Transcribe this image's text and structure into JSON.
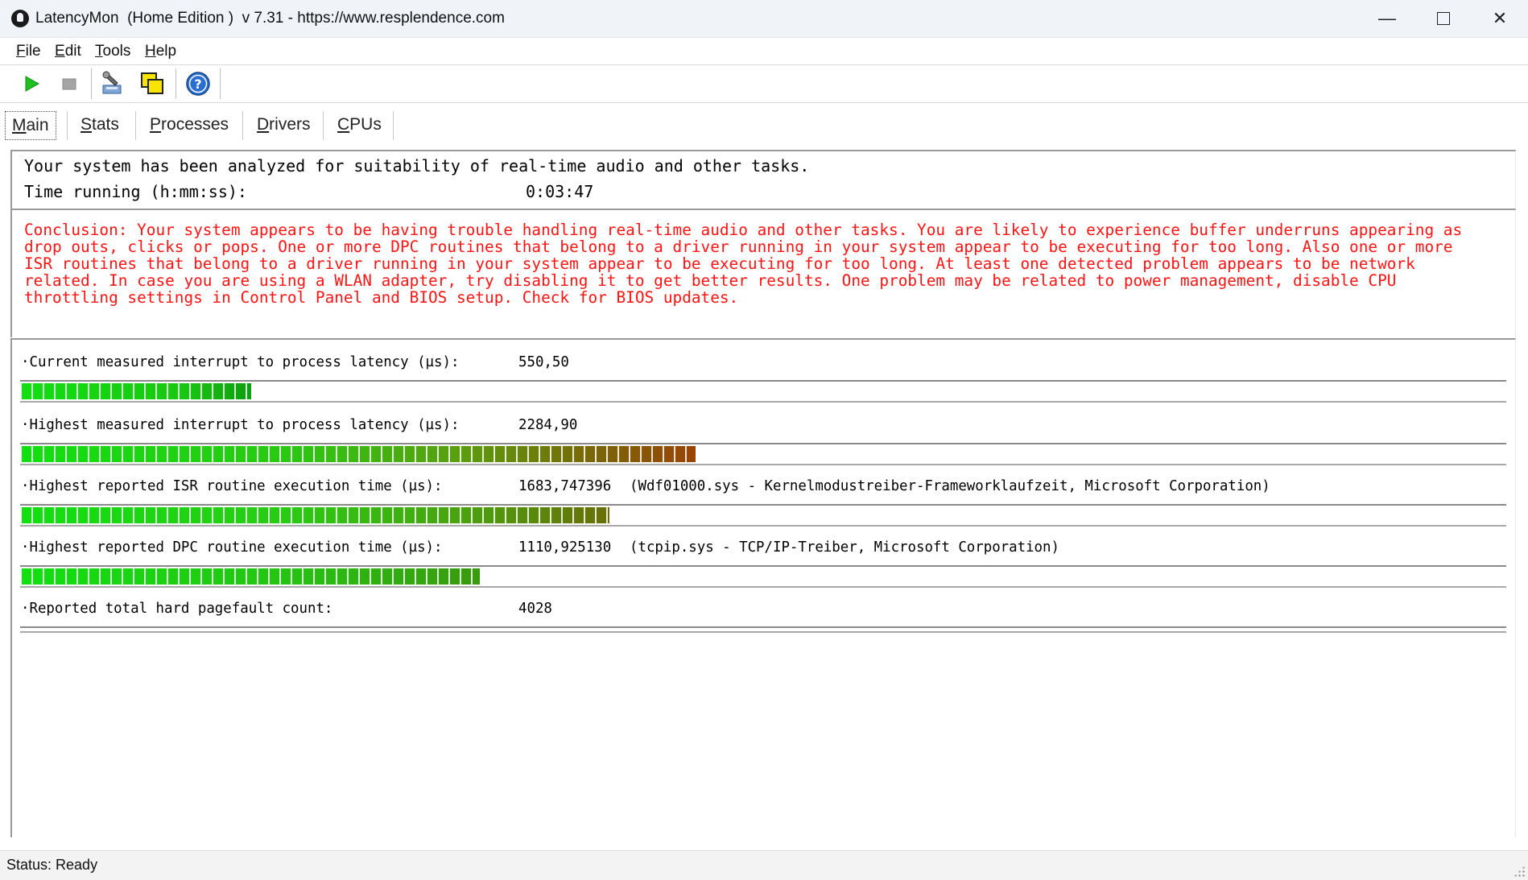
{
  "window": {
    "title": "LatencyMon  (Home Edition )  v 7.31 - https://www.resplendence.com",
    "minimize_glyph": "—",
    "close_glyph": "✕"
  },
  "menu": {
    "items": [
      {
        "label": "File"
      },
      {
        "label": "Edit"
      },
      {
        "label": "Tools"
      },
      {
        "label": "Help"
      }
    ]
  },
  "toolbar": {
    "icons": [
      "play-icon",
      "stop-icon",
      "driver-tool-icon",
      "copy-windows-icon",
      "help-icon"
    ],
    "colors": {
      "play": "#1fbf1f",
      "stop": "#a0a0a0",
      "help": "#1f5fbf"
    }
  },
  "tabs": [
    {
      "label": "Main",
      "active": true
    },
    {
      "label": "Stats"
    },
    {
      "label": "Processes"
    },
    {
      "label": "Drivers"
    },
    {
      "label": "CPUs"
    }
  ],
  "summary": {
    "analyzed_text": "Your system has been analyzed for suitability of real-time audio and other tasks.",
    "time_label": "Time running (h:mm:ss):",
    "time_value": "0:03:47"
  },
  "conclusion": {
    "text": "Conclusion: Your system appears to be having trouble handling real-time audio and other tasks. You are likely to experience buffer underruns appearing as\ndrop outs, clicks or pops. One or more DPC routines that belong to a driver running in your system appear to be executing for too long. Also one or more\nISR routines that belong to a driver running in your system appear to be executing for too long. At least one detected problem appears to be network\nrelated. In case you are using a WLAN adapter, try disabling it to get better results. One problem may be related to power management, disable CPU\nthrottling settings in Control Panel and BIOS setup. Check for BIOS updates.",
    "color": "#ff1414"
  },
  "metrics": [
    {
      "label": "·Current measured interrupt to process latency (µs):",
      "value": "550,50",
      "detail": "",
      "bar_fraction": 0.155
    },
    {
      "label": "·Highest measured interrupt to process latency (µs):",
      "value": "2284,90",
      "detail": "",
      "bar_fraction": 0.455
    },
    {
      "label": "·Highest reported ISR routine execution time (µs):",
      "value": "1683,747396",
      "detail": "(Wdf01000.sys - Kernelmodustreiber-Frameworklaufzeit, Microsoft Corporation)",
      "bar_fraction": 0.397
    },
    {
      "label": "·Highest reported DPC routine execution time (µs):",
      "value": "1110,925130",
      "detail": "(tcpip.sys - TCP/IP-Treiber, Microsoft Corporation)",
      "bar_fraction": 0.309
    },
    {
      "label": "·Reported total hard pagefault count:",
      "value": "4028",
      "detail": ""
    }
  ],
  "status": {
    "text": "Status: Ready"
  }
}
